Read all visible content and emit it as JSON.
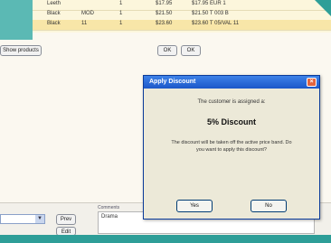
{
  "grid": {
    "rows": [
      {
        "name": "Leeth",
        "col2": "",
        "qty": "1",
        "price": "$17.95",
        "total": "$17.95 EUR 1"
      },
      {
        "name": "Black",
        "col2": "MOD",
        "qty": "1",
        "price": "$21.50",
        "total": "$21.50 T 003 B"
      },
      {
        "name": "Black",
        "col2": "11",
        "qty": "1",
        "price": "$23.60",
        "total": "$23.60 T 05/VAL 11"
      }
    ]
  },
  "toolbar": {
    "left_button": "Show products",
    "mid_button_1": "OK",
    "mid_button_2": "OK"
  },
  "bottom": {
    "notes_label": "Comments",
    "notes_text": "Drama",
    "button_1": "Prev",
    "button_2": "Edit"
  },
  "dialog": {
    "title": "Apply Discount",
    "close_glyph": "×",
    "line1": "The customer is assigned a:",
    "discount": "5% Discount",
    "body": "The discount will be taken off the active price band. Do you want to apply this discount?",
    "yes_label": "Yes",
    "no_label": "No"
  }
}
